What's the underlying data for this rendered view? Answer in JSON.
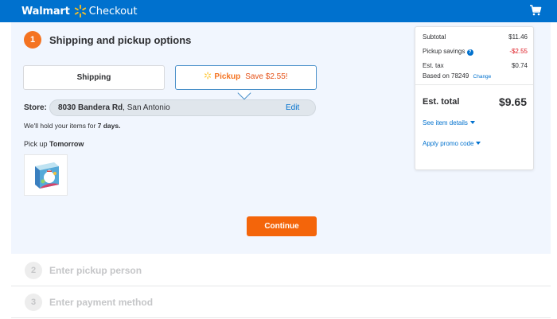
{
  "header": {
    "brand": "Walmart",
    "subtitle": "Checkout",
    "spark_icon": "walmart-spark-icon",
    "cart_icon": "cart-icon",
    "bg_color": "#0071ce"
  },
  "step1": {
    "number": "1",
    "title": "Shipping and pickup options",
    "tabs": {
      "shipping_label": "Shipping",
      "pickup_label": "Pickup",
      "pickup_savings": "Save $2.55!"
    },
    "store": {
      "label": "Store:",
      "name": "8030 Bandera Rd",
      "city": ", San Antonio",
      "edit_label": "Edit"
    },
    "hold_prefix": "We'll hold your items for ",
    "hold_days": "7 days.",
    "pickup_prefix": "Pick up ",
    "pickup_day": "Tomorrow",
    "continue_label": "Continue",
    "accent_color": "#f47321"
  },
  "step2": {
    "number": "2",
    "title": "Enter pickup person"
  },
  "step3": {
    "number": "3",
    "title": "Enter payment method"
  },
  "summary": {
    "subtotal_label": "Subtotal",
    "subtotal_value": "$11.46",
    "savings_label": "Pickup savings",
    "savings_value": "-$2.55",
    "tax_label": "Est. tax",
    "tax_value": "$0.74",
    "based_on": "Based on 78249",
    "change_label": "Change",
    "total_label": "Est. total",
    "total_value": "$9.65",
    "see_items_label": "See item details",
    "promo_label": "Apply promo code"
  }
}
